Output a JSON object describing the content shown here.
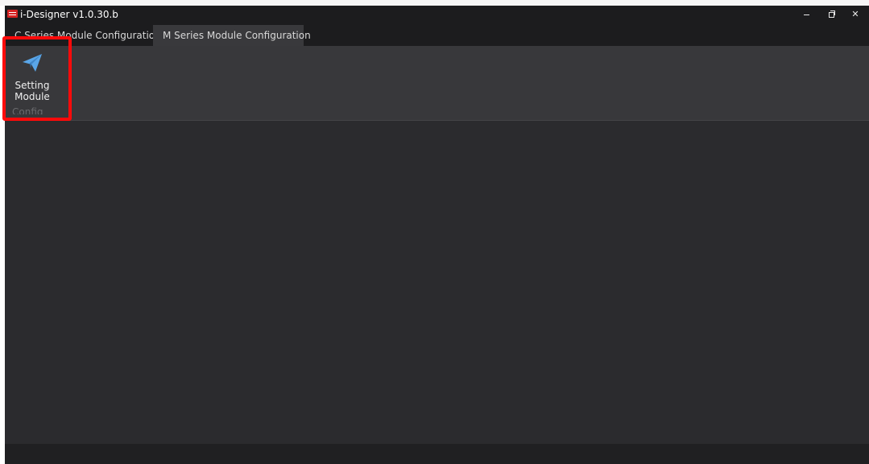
{
  "window": {
    "title": "i-Designer v1.0.30.b",
    "min_glyph": "–",
    "close_glyph": "✕"
  },
  "tabs": [
    {
      "label": "C Series Module Configuration",
      "active": false
    },
    {
      "label": "M Series Module Configuration",
      "active": true
    }
  ],
  "ribbon": {
    "setting_module_label": "Setting\nModule",
    "group_label": "Config"
  },
  "icons": {
    "app_logo": "app-logo-icon",
    "setting_module": "paper-plane-icon"
  },
  "colors": {
    "accent_blue": "#5aa6e8",
    "highlight_red": "#ff0a0a",
    "logo_red": "#d62222"
  }
}
